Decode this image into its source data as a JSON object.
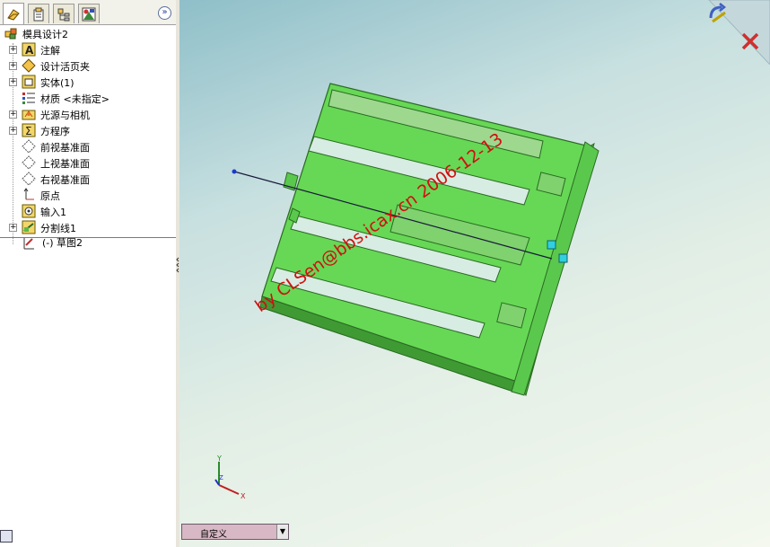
{
  "tree": {
    "root": "模具设计2",
    "items": [
      {
        "label": "注解",
        "icon": "annotation-icon",
        "expandable": true
      },
      {
        "label": "设计活页夹",
        "icon": "design-binder-icon",
        "expandable": true
      },
      {
        "label": "实体(1)",
        "icon": "solid-bodies-icon",
        "expandable": true
      },
      {
        "label": "材质 <未指定>",
        "icon": "material-icon",
        "expandable": false
      },
      {
        "label": "光源与相机",
        "icon": "lights-cameras-icon",
        "expandable": true
      },
      {
        "label": "方程序",
        "icon": "equations-icon",
        "expandable": true
      },
      {
        "label": "前视基准面",
        "icon": "plane-icon",
        "expandable": false
      },
      {
        "label": "上视基准面",
        "icon": "plane-icon",
        "expandable": false
      },
      {
        "label": "右视基准面",
        "icon": "plane-icon",
        "expandable": false
      },
      {
        "label": "原点",
        "icon": "origin-icon",
        "expandable": false
      },
      {
        "label": "输入1",
        "icon": "imported-body-icon",
        "expandable": false
      },
      {
        "label": "分割线1",
        "icon": "split-line-icon",
        "expandable": true
      }
    ],
    "sketch": "(-) 草图2"
  },
  "tabs": [
    "feature-manager-icon",
    "property-manager-icon",
    "configuration-manager-icon",
    "display-manager-icon"
  ],
  "watermark": "by CLSen@bbs.icax.cn 2006-12-13",
  "config_select": "自定义",
  "triad": {
    "x": "X",
    "y": "Y",
    "z": "Z"
  },
  "colors": {
    "part": "#66d855",
    "part_dark": "#3f9a33",
    "watermark": "#d01010"
  }
}
